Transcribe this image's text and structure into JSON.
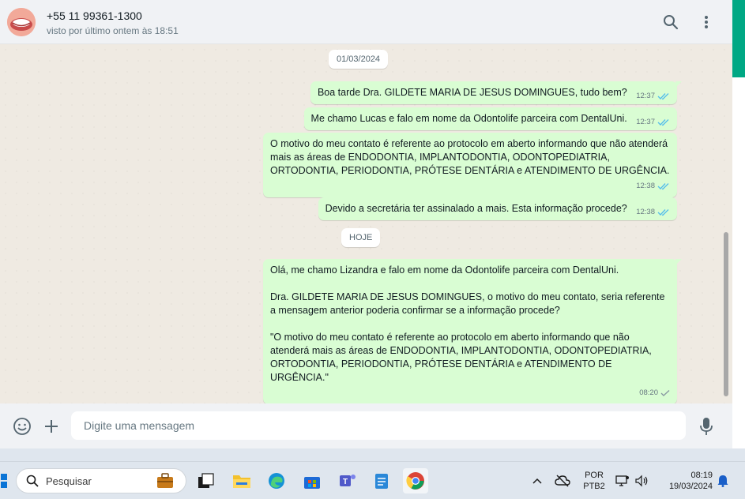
{
  "header": {
    "contact_name": "+55 11 99361-1300",
    "contact_status": "visto por último ontem às 18:51",
    "icons": [
      "search-icon",
      "menu-dots-icon"
    ]
  },
  "chat": {
    "date_1": "01/03/2024",
    "date_2": "HOJE",
    "messages": [
      {
        "text": "Boa tarde Dra. GILDETE MARIA DE JESUS DOMINGUES, tudo bem?",
        "time": "12:37",
        "status": "read"
      },
      {
        "text": "Me chamo Lucas e falo em nome da Odontolife parceira com DentalUni.",
        "time": "12:37",
        "status": "read"
      },
      {
        "text": "O motivo do meu contato é referente ao protocolo em aberto informando que não atenderá mais as áreas de ENDODONTIA, IMPLANTODONTIA, ODONTOPEDIATRIA, ORTODONTIA, PERIODONTIA, PRÓTESE DENTÁRIA e ATENDIMENTO DE URGÊNCIA.",
        "time": "12:38",
        "status": "read"
      },
      {
        "text": "Devido a secretária ter assinalado a mais. Esta informação procede?",
        "time": "12:38",
        "status": "read"
      },
      {
        "text": "Olá, me chamo Lizandra e falo em nome da Odontolife parceira com DentalUni.\n\nDra. GILDETE MARIA DE JESUS DOMINGUES, o motivo do meu contato, seria referente a mensagem anterior poderia confirmar se a informação procede?\n\n\"O motivo do meu contato é referente ao protocolo em aberto informando que não atenderá mais as áreas de ENDODONTIA, IMPLANTODONTIA, ODONTOPEDIATRIA, ORTODONTIA, PERIODONTIA, PRÓTESE DENTÁRIA e ATENDIMENTO DE URGÊNCIA.\"",
        "time": "08:20",
        "status": "sent"
      }
    ]
  },
  "footer": {
    "placeholder": "Digite uma mensagem",
    "icons": [
      "emoji-icon",
      "plus-icon",
      "microphone-icon"
    ]
  },
  "taskbar": {
    "search_label": "Pesquisar",
    "lang_top": "POR",
    "lang_bottom": "PTB2",
    "time": "08:19",
    "date": "19/03/2024",
    "apps": [
      "widgets-icon",
      "task-view-icon",
      "file-explorer-icon",
      "edge-icon",
      "store-icon",
      "teams-icon",
      "notepad-icon",
      "chrome-icon"
    ]
  },
  "colors": {
    "bubble_out": "#d9fdd3",
    "header_bg": "#f0f2f5",
    "chat_bg": "#efeae2",
    "read_tick": "#53bdeb",
    "accent": "#00a884"
  }
}
